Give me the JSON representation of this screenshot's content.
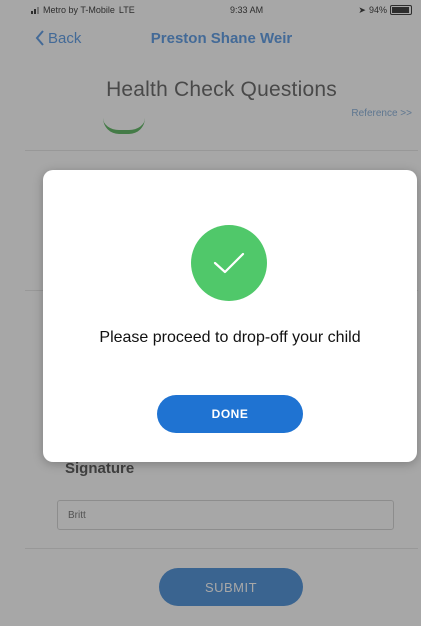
{
  "status_bar": {
    "carrier": "Metro by T-Mobile",
    "network": "LTE",
    "time": "9:33 AM",
    "battery": "94%",
    "battery_level": 0.94
  },
  "nav": {
    "back_label": "Back",
    "title": "Preston Shane Weir"
  },
  "screen": {
    "section_title": "Health Check Questions",
    "reference_link": "Reference >>"
  },
  "signature": {
    "label": "Signature",
    "value": "Britt"
  },
  "submit_label": "SUBMIT",
  "modal": {
    "message": "Please proceed to drop-off your child",
    "done_label": "DONE"
  },
  "colors": {
    "accent": "#1f73d2",
    "success": "#50c86a"
  }
}
